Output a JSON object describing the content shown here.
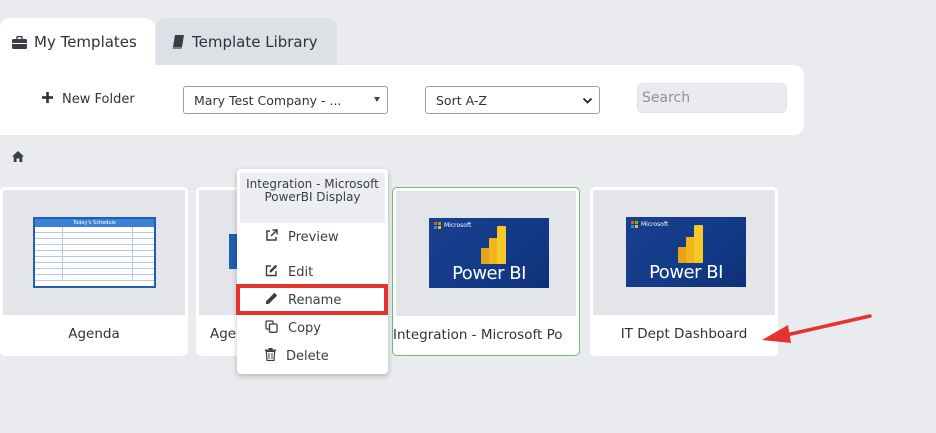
{
  "tabs": [
    {
      "label": "My Templates",
      "icon": "briefcase-icon",
      "active": true
    },
    {
      "label": "Template Library",
      "icon": "book-icon",
      "active": false
    }
  ],
  "toolbar": {
    "new_folder_label": "New Folder",
    "company_select_value": "Mary Test Company - ...",
    "sort_select_value": "Sort A-Z",
    "search_placeholder": "Search"
  },
  "breadcrumb": {
    "icon": "home-icon"
  },
  "templates": [
    {
      "title": "Agenda",
      "thumbnail": "schedule",
      "thumbnail_title": "Today's Schedule"
    },
    {
      "title": "Age",
      "thumbnail": "blue"
    },
    {
      "title": "Integration - Microsoft Po",
      "thumbnail": "power-bi",
      "selected": true
    },
    {
      "title": "IT Dept Dashboard",
      "thumbnail": "power-bi"
    }
  ],
  "power_bi_thumb": {
    "microsoft_label": "Microsoft",
    "product_label": "Power BI"
  },
  "context_menu": {
    "header": "Integration - Microsoft PowerBI Display",
    "items": [
      {
        "label": "Preview",
        "icon": "external-link-icon"
      },
      {
        "label": "Edit",
        "icon": "edit-icon"
      },
      {
        "label": "Rename",
        "icon": "pencil-icon",
        "highlighted": true
      },
      {
        "label": "Copy",
        "icon": "copy-icon"
      },
      {
        "label": "Delete",
        "icon": "trash-icon"
      }
    ]
  },
  "colors": {
    "highlight": "#e3342f",
    "arrow": "#e3342f",
    "selected_border": "#6cc46c",
    "page_bg": "#e9ebef"
  }
}
